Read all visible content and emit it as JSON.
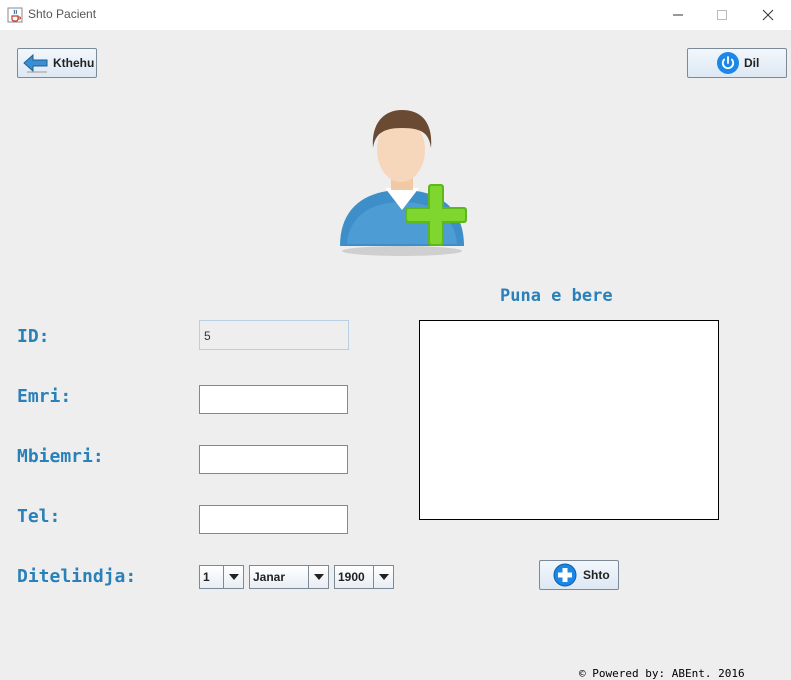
{
  "window": {
    "title": "Shto Pacient"
  },
  "toolbar": {
    "back_label": "Kthehu",
    "exit_label": "Dil"
  },
  "section": {
    "work_title": "Puna e bere"
  },
  "form": {
    "id_label": "ID:",
    "id_value": "5",
    "name_label": "Emri:",
    "surname_label": "Mbiemri:",
    "phone_label": "Tel:",
    "birth_label": "Ditelindja:",
    "day": "1",
    "month": "Janar",
    "year": "1900"
  },
  "actions": {
    "add_label": "Shto"
  },
  "footer": {
    "text": "© Powered by: ABEnt. 2016"
  },
  "colors": {
    "label": "#2a80b9",
    "accent": "#1b87e6",
    "plus": "#6cc417"
  },
  "icons": [
    "java-icon",
    "minimize-icon",
    "maximize-icon",
    "close-icon",
    "back-arrow-icon",
    "power-icon",
    "add-user-icon",
    "plus-circle-icon",
    "chevron-down-icon"
  ]
}
